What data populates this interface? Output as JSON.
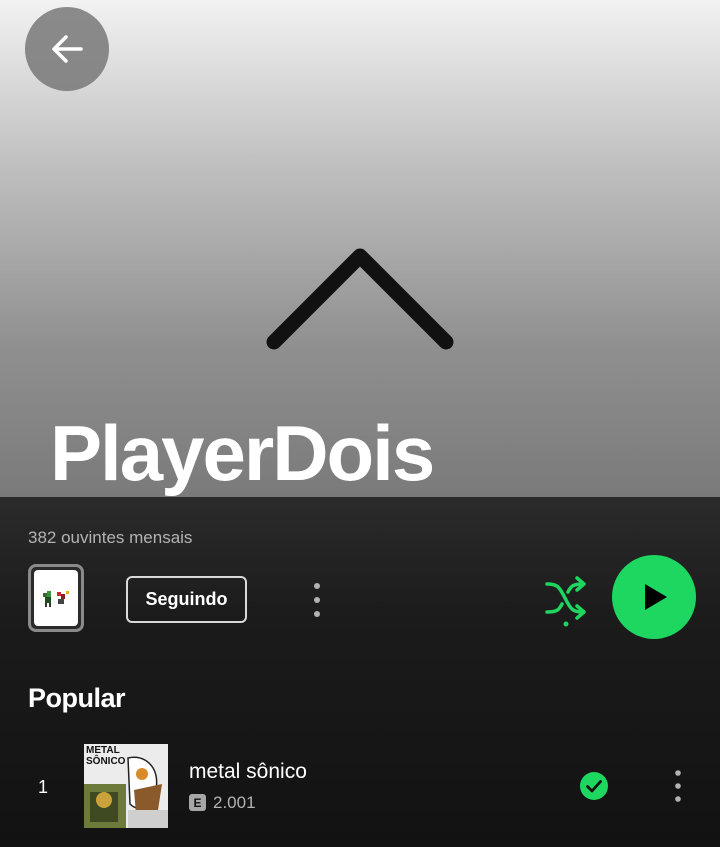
{
  "artist": {
    "name": "PlayerDois",
    "monthly_listeners": "382 ouvintes mensais"
  },
  "actions": {
    "follow_label": "Seguindo"
  },
  "popular": {
    "title": "Popular",
    "tracks": [
      {
        "rank": "1",
        "title": "metal sônico",
        "explicit_label": "E",
        "plays": "2.001",
        "art_text": "METAL SÔNICO"
      }
    ]
  },
  "colors": {
    "accent": "#1ed760",
    "background": "#121212"
  },
  "icons": {
    "back": "arrow-left-icon",
    "collapse": "chevron-up-icon",
    "shuffle": "shuffle-icon",
    "play": "play-icon",
    "more": "more-vertical-icon",
    "saved": "check-circle-icon"
  }
}
